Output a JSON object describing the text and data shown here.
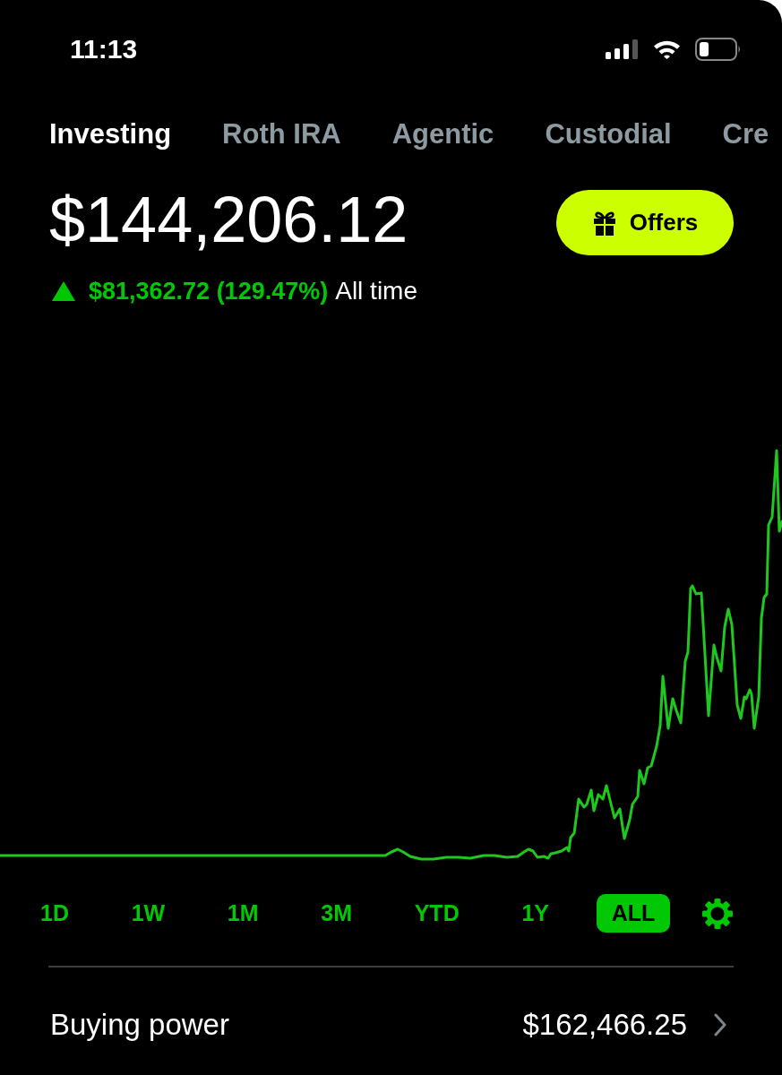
{
  "status_bar": {
    "time": "11:13"
  },
  "tabs": [
    {
      "label": "Investing",
      "selected": true
    },
    {
      "label": "Roth IRA",
      "selected": false
    },
    {
      "label": "Agentic",
      "selected": false
    },
    {
      "label": "Custodial",
      "selected": false
    },
    {
      "label": "Cre",
      "selected": false
    }
  ],
  "portfolio": {
    "value": "$144,206.12",
    "offers_button": {
      "label": "Offers"
    },
    "change": {
      "gain": true,
      "amount": "$81,362.72 (129.47%)",
      "period": "All time"
    }
  },
  "ranges": [
    {
      "label": "1D",
      "selected": false
    },
    {
      "label": "1W",
      "selected": false
    },
    {
      "label": "1M",
      "selected": false
    },
    {
      "label": "3M",
      "selected": false
    },
    {
      "label": "YTD",
      "selected": false
    },
    {
      "label": "1Y",
      "selected": false
    },
    {
      "label": "ALL",
      "selected": true
    }
  ],
  "buying_power": {
    "label": "Buying power",
    "value": "$162,466.25"
  }
}
